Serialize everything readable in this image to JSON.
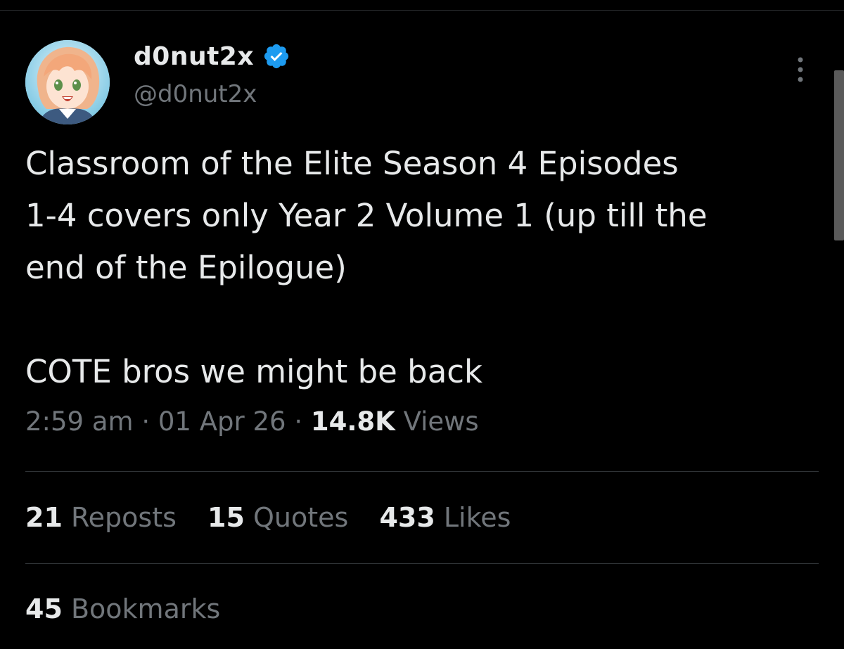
{
  "author": {
    "display_name": "d0nut2x",
    "handle": "@d0nut2x",
    "verified": true,
    "avatar_icon": "anime-avatar",
    "badge_color": "#1d9bf0"
  },
  "tweet": {
    "text": "Classroom of the Elite Season 4 Episodes\n1-4 covers only Year 2 Volume 1 (up till the\nend of the Epilogue)\n\nCOTE bros we might be back",
    "time": "2:59 am",
    "separator": "·",
    "date": "01 Apr 26",
    "views_count": "14.8K",
    "views_label": "Views"
  },
  "stats": {
    "reposts_count": "21",
    "reposts_label": "Reposts",
    "quotes_count": "15",
    "quotes_label": "Quotes",
    "likes_count": "433",
    "likes_label": "Likes",
    "bookmarks_count": "45",
    "bookmarks_label": "Bookmarks"
  },
  "colors": {
    "background": "#000000",
    "text_primary": "#e7e9ea",
    "text_secondary": "#71767b",
    "divider": "#2f3336"
  }
}
